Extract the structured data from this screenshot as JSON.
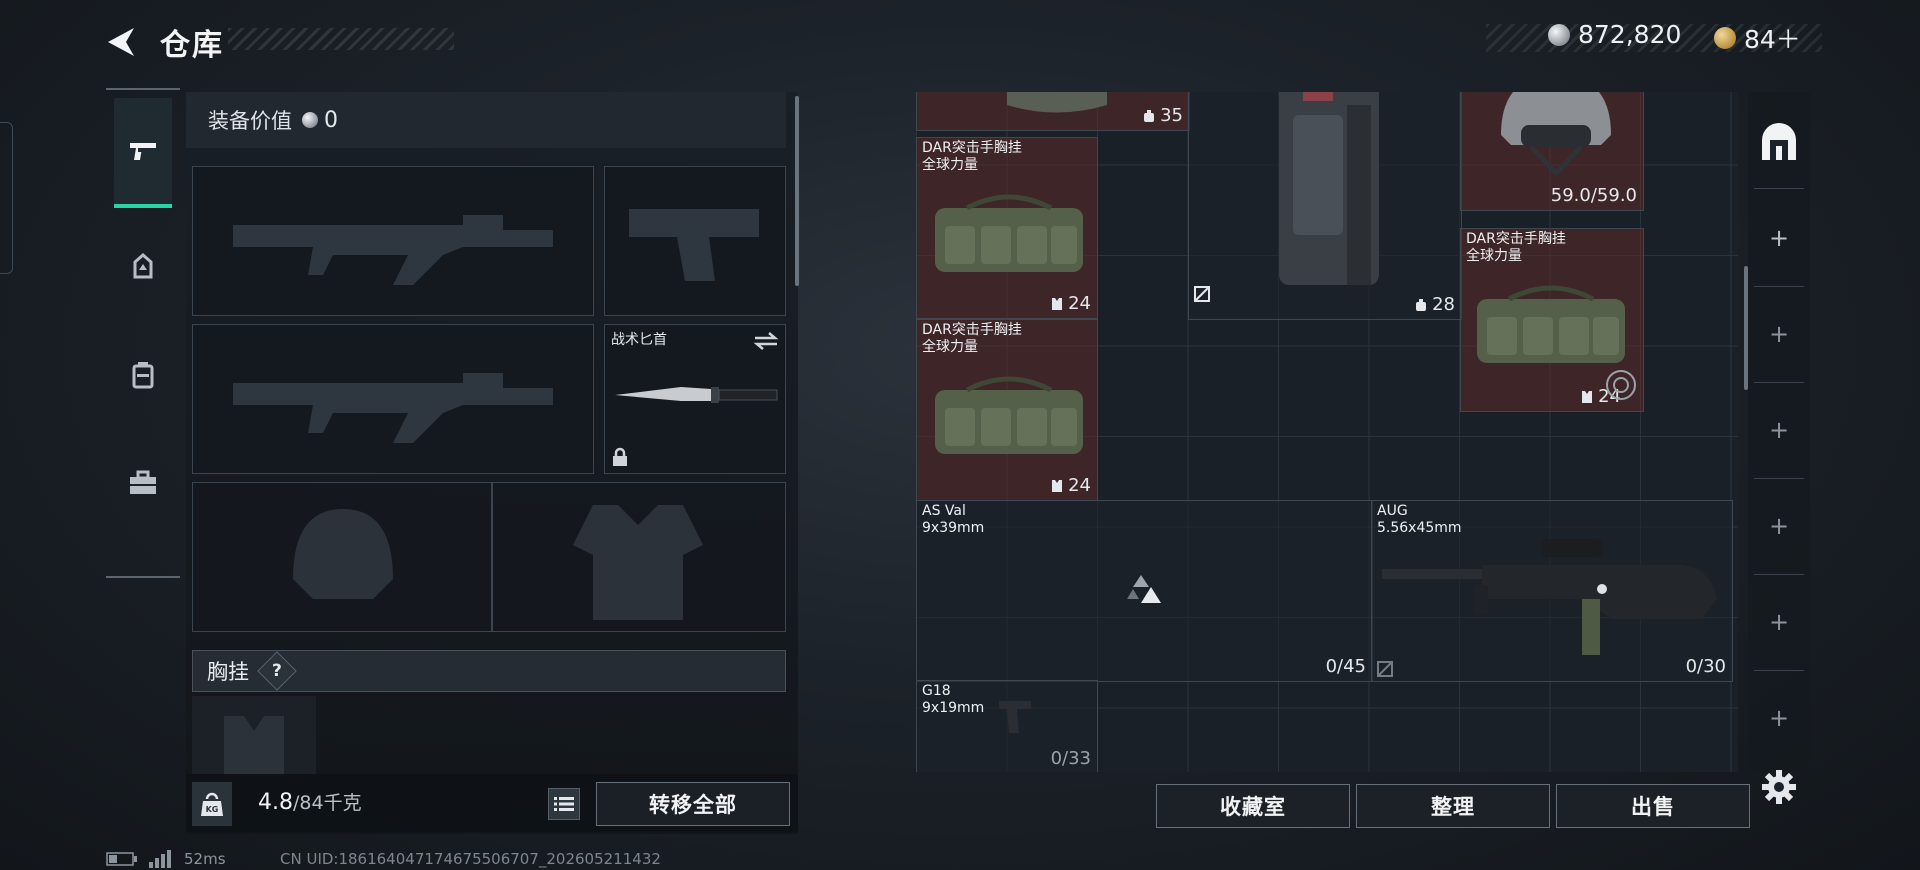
{
  "header": {
    "title": "仓库"
  },
  "currency": {
    "silver": "872,820",
    "gold": "84＋",
    "silver_color": "#c8ccd0",
    "gold_color": "#c9a055"
  },
  "left_rail": {
    "tabs": [
      {
        "icon": "pistol-icon",
        "active": true
      },
      {
        "icon": "helmet-icon",
        "active": false
      },
      {
        "icon": "backpack-icon",
        "active": false
      },
      {
        "icon": "toolbox-icon",
        "active": false
      }
    ]
  },
  "loadout": {
    "value_label": "装备价值",
    "value": "0",
    "knife_label": "战术匕首",
    "chest_label": "胸挂",
    "chest_help": "?",
    "weight_current": "4.8",
    "weight_max": "/84千克",
    "transfer_all": "转移全部"
  },
  "stash": {
    "items": [
      {
        "name": "",
        "qty": "35",
        "qty_icon": "backpack-mini-icon"
      },
      {
        "name": "DAR突击手胸挂\n全球力量",
        "qty": "24",
        "qty_icon": "vest-mini-icon"
      },
      {
        "name": "",
        "qty": "28",
        "qty_icon": "backpack-mini-icon",
        "no_insure": true
      },
      {
        "name": "",
        "qty": "59.0/59.0"
      },
      {
        "name": "DAR突击手胸挂\n全球力量",
        "qty": "24",
        "qty_icon": "vest-mini-icon"
      },
      {
        "name": "DAR突击手胸挂\n全球力量",
        "qty": "24",
        "qty_icon": "vest-mini-icon"
      },
      {
        "name": "AS Val\n9x39mm",
        "qty": "0/45",
        "no_insure": true
      },
      {
        "name": "AUG\n5.56x45mm",
        "qty": "0/30"
      },
      {
        "name": "G18\n9x19mm",
        "qty": "0/33"
      }
    ]
  },
  "actions": {
    "collection": "收藏室",
    "sort": "整理",
    "sell": "出售"
  },
  "footer": {
    "ping": "52ms",
    "uid": "CN UID:186164047174675506707_202605211432"
  }
}
